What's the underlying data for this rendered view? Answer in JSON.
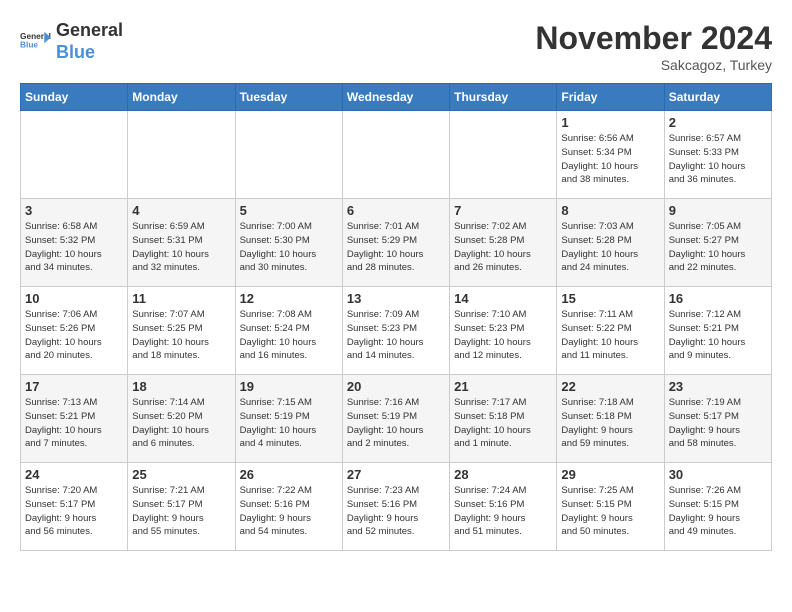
{
  "header": {
    "logo_line1": "General",
    "logo_line2": "Blue",
    "month_title": "November 2024",
    "subtitle": "Sakcagoz, Turkey"
  },
  "weekdays": [
    "Sunday",
    "Monday",
    "Tuesday",
    "Wednesday",
    "Thursday",
    "Friday",
    "Saturday"
  ],
  "weeks": [
    [
      {
        "day": "",
        "info": ""
      },
      {
        "day": "",
        "info": ""
      },
      {
        "day": "",
        "info": ""
      },
      {
        "day": "",
        "info": ""
      },
      {
        "day": "",
        "info": ""
      },
      {
        "day": "1",
        "info": "Sunrise: 6:56 AM\nSunset: 5:34 PM\nDaylight: 10 hours\nand 38 minutes."
      },
      {
        "day": "2",
        "info": "Sunrise: 6:57 AM\nSunset: 5:33 PM\nDaylight: 10 hours\nand 36 minutes."
      }
    ],
    [
      {
        "day": "3",
        "info": "Sunrise: 6:58 AM\nSunset: 5:32 PM\nDaylight: 10 hours\nand 34 minutes."
      },
      {
        "day": "4",
        "info": "Sunrise: 6:59 AM\nSunset: 5:31 PM\nDaylight: 10 hours\nand 32 minutes."
      },
      {
        "day": "5",
        "info": "Sunrise: 7:00 AM\nSunset: 5:30 PM\nDaylight: 10 hours\nand 30 minutes."
      },
      {
        "day": "6",
        "info": "Sunrise: 7:01 AM\nSunset: 5:29 PM\nDaylight: 10 hours\nand 28 minutes."
      },
      {
        "day": "7",
        "info": "Sunrise: 7:02 AM\nSunset: 5:28 PM\nDaylight: 10 hours\nand 26 minutes."
      },
      {
        "day": "8",
        "info": "Sunrise: 7:03 AM\nSunset: 5:28 PM\nDaylight: 10 hours\nand 24 minutes."
      },
      {
        "day": "9",
        "info": "Sunrise: 7:05 AM\nSunset: 5:27 PM\nDaylight: 10 hours\nand 22 minutes."
      }
    ],
    [
      {
        "day": "10",
        "info": "Sunrise: 7:06 AM\nSunset: 5:26 PM\nDaylight: 10 hours\nand 20 minutes."
      },
      {
        "day": "11",
        "info": "Sunrise: 7:07 AM\nSunset: 5:25 PM\nDaylight: 10 hours\nand 18 minutes."
      },
      {
        "day": "12",
        "info": "Sunrise: 7:08 AM\nSunset: 5:24 PM\nDaylight: 10 hours\nand 16 minutes."
      },
      {
        "day": "13",
        "info": "Sunrise: 7:09 AM\nSunset: 5:23 PM\nDaylight: 10 hours\nand 14 minutes."
      },
      {
        "day": "14",
        "info": "Sunrise: 7:10 AM\nSunset: 5:23 PM\nDaylight: 10 hours\nand 12 minutes."
      },
      {
        "day": "15",
        "info": "Sunrise: 7:11 AM\nSunset: 5:22 PM\nDaylight: 10 hours\nand 11 minutes."
      },
      {
        "day": "16",
        "info": "Sunrise: 7:12 AM\nSunset: 5:21 PM\nDaylight: 10 hours\nand 9 minutes."
      }
    ],
    [
      {
        "day": "17",
        "info": "Sunrise: 7:13 AM\nSunset: 5:21 PM\nDaylight: 10 hours\nand 7 minutes."
      },
      {
        "day": "18",
        "info": "Sunrise: 7:14 AM\nSunset: 5:20 PM\nDaylight: 10 hours\nand 6 minutes."
      },
      {
        "day": "19",
        "info": "Sunrise: 7:15 AM\nSunset: 5:19 PM\nDaylight: 10 hours\nand 4 minutes."
      },
      {
        "day": "20",
        "info": "Sunrise: 7:16 AM\nSunset: 5:19 PM\nDaylight: 10 hours\nand 2 minutes."
      },
      {
        "day": "21",
        "info": "Sunrise: 7:17 AM\nSunset: 5:18 PM\nDaylight: 10 hours\nand 1 minute."
      },
      {
        "day": "22",
        "info": "Sunrise: 7:18 AM\nSunset: 5:18 PM\nDaylight: 9 hours\nand 59 minutes."
      },
      {
        "day": "23",
        "info": "Sunrise: 7:19 AM\nSunset: 5:17 PM\nDaylight: 9 hours\nand 58 minutes."
      }
    ],
    [
      {
        "day": "24",
        "info": "Sunrise: 7:20 AM\nSunset: 5:17 PM\nDaylight: 9 hours\nand 56 minutes."
      },
      {
        "day": "25",
        "info": "Sunrise: 7:21 AM\nSunset: 5:17 PM\nDaylight: 9 hours\nand 55 minutes."
      },
      {
        "day": "26",
        "info": "Sunrise: 7:22 AM\nSunset: 5:16 PM\nDaylight: 9 hours\nand 54 minutes."
      },
      {
        "day": "27",
        "info": "Sunrise: 7:23 AM\nSunset: 5:16 PM\nDaylight: 9 hours\nand 52 minutes."
      },
      {
        "day": "28",
        "info": "Sunrise: 7:24 AM\nSunset: 5:16 PM\nDaylight: 9 hours\nand 51 minutes."
      },
      {
        "day": "29",
        "info": "Sunrise: 7:25 AM\nSunset: 5:15 PM\nDaylight: 9 hours\nand 50 minutes."
      },
      {
        "day": "30",
        "info": "Sunrise: 7:26 AM\nSunset: 5:15 PM\nDaylight: 9 hours\nand 49 minutes."
      }
    ]
  ]
}
